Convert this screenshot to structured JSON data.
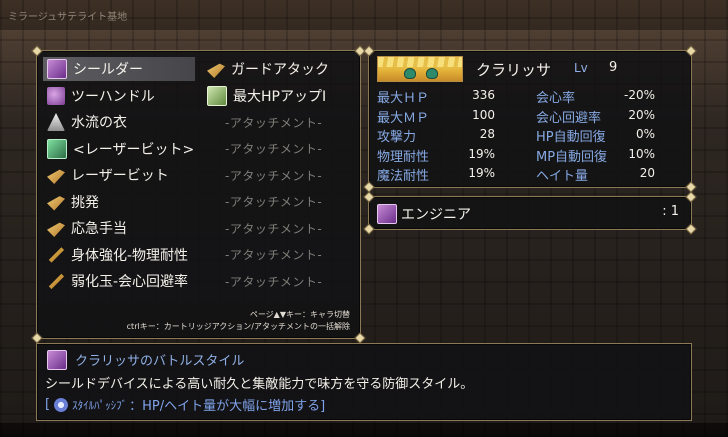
{
  "header": {
    "area_label": "ミラージュサテライト基地"
  },
  "skills": [
    {
      "name": "シールダー",
      "icon": "shield-icon",
      "selected": true
    },
    {
      "name": "ツーハンドル",
      "icon": "hand-icon"
    },
    {
      "name": "水流の衣",
      "icon": "robe-icon"
    },
    {
      "name": "<レーザービット>",
      "icon": "bit-icon"
    },
    {
      "name": "レーザービット",
      "icon": "gun-icon"
    },
    {
      "name": "挑発",
      "icon": "gun-icon"
    },
    {
      "name": "応急手当",
      "icon": "gun-icon"
    },
    {
      "name": "身体強化-物理耐性",
      "icon": "cartridge-icon"
    },
    {
      "name": "弱化玉-会心回避率",
      "icon": "cartridge-icon"
    }
  ],
  "attachments": [
    {
      "name": "ガードアタック",
      "icon": "tool-icon"
    },
    {
      "name": "最大HPアップⅠ",
      "icon": "card-icon"
    },
    {
      "name": "-アタッチメント-"
    },
    {
      "name": "-アタッチメント-"
    },
    {
      "name": "-アタッチメント-"
    },
    {
      "name": "-アタッチメント-"
    },
    {
      "name": "-アタッチメント-"
    },
    {
      "name": "-アタッチメント-"
    },
    {
      "name": "-アタッチメント-"
    }
  ],
  "hints": {
    "line1": "ページ▲▼キー：キャラ切替",
    "line2": "ctrlキー：カートリッジアクション/アタッチメントの一括解除"
  },
  "character": {
    "name": "クラリッサ",
    "lv_label": "Lv",
    "lv": "9",
    "stats_left": [
      {
        "label": "最大ＨＰ",
        "value": "336"
      },
      {
        "label": "最大ＭＰ",
        "value": "100"
      },
      {
        "label": "攻撃力",
        "value": "28"
      },
      {
        "label": "物理耐性",
        "value": "19%"
      },
      {
        "label": "魔法耐性",
        "value": "19%"
      }
    ],
    "stats_right": [
      {
        "label": "会心率",
        "value": "-20%"
      },
      {
        "label": "会心回避率",
        "value": "20%"
      },
      {
        "label": "HP自動回復",
        "value": "0%"
      },
      {
        "label": "MP自動回復",
        "value": "10%"
      },
      {
        "label": "ヘイト量",
        "value": "20"
      }
    ]
  },
  "job": {
    "name": "エンジニア",
    "level": ": 1"
  },
  "description": {
    "title": "クラリッサのバトルスタイル",
    "text": "シールドデバイスによる高い耐久と集敵能力で味方を守る防御スタイル。",
    "passive_open": "[",
    "passive_tag": "ｽﾀｲﾙﾊﾟｯｼﾌﾞ",
    "passive_text": "：HP/ヘイト量が大幅に増加する]"
  },
  "colors": {
    "accent_blue": "#86a9e4",
    "frame_gold": "#8c7a56",
    "selected_bg": "#5e5e62"
  }
}
